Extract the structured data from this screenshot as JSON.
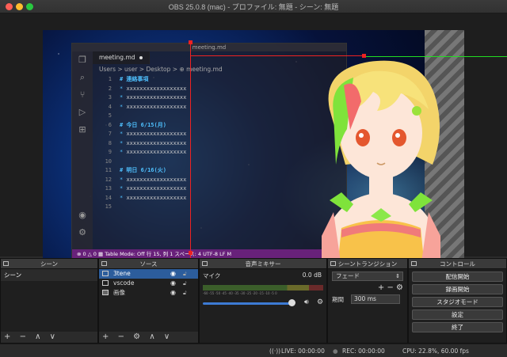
{
  "window": {
    "title": "OBS 25.0.8 (mac) - プロファイル: 無題 - シーン: 無題"
  },
  "preview": {
    "vscode": {
      "title": "meeting.md",
      "tab": "meeting.md",
      "breadcrumb": "Users > user > Desktop > ⊕ meeting.md",
      "lines": [
        {
          "n": "1",
          "kind": "hdr",
          "text": "# 連絡事項"
        },
        {
          "n": "2",
          "kind": "bul",
          "text": "xxxxxxxxxxxxxxxxxx"
        },
        {
          "n": "3",
          "kind": "bul",
          "text": "xxxxxxxxxxxxxxxxxx"
        },
        {
          "n": "4",
          "kind": "bul",
          "text": "xxxxxxxxxxxxxxxxxx"
        },
        {
          "n": "5",
          "kind": "blank",
          "text": ""
        },
        {
          "n": "6",
          "kind": "hdr",
          "text": "# 今日 6/15(月)"
        },
        {
          "n": "7",
          "kind": "bul",
          "text": "xxxxxxxxxxxxxxxxxx"
        },
        {
          "n": "8",
          "kind": "bul",
          "text": "xxxxxxxxxxxxxxxxxx"
        },
        {
          "n": "9",
          "kind": "bul",
          "text": "xxxxxxxxxxxxxxxxxx"
        },
        {
          "n": "10",
          "kind": "blank",
          "text": ""
        },
        {
          "n": "11",
          "kind": "hdr",
          "text": "# 明日 6/16(火)"
        },
        {
          "n": "12",
          "kind": "bul",
          "text": "xxxxxxxxxxxxxxxxxx"
        },
        {
          "n": "13",
          "kind": "bul",
          "text": "xxxxxxxxxxxxxxxxxx"
        },
        {
          "n": "14",
          "kind": "bul",
          "text": "xxxxxxxxxxxxxxxxxx"
        },
        {
          "n": "15",
          "kind": "blank",
          "text": ""
        }
      ],
      "status": "⊗ 0 △ 0   ▦ Table Mode: Off       行 15, 列 1   スペース: 4   UTF-8   LF   M"
    }
  },
  "docks": {
    "scenes": {
      "title": "シーン",
      "items": [
        "シーン"
      ],
      "footer": [
        "+",
        "−",
        "∧",
        "∨"
      ]
    },
    "sources": {
      "title": "ソース",
      "items": [
        {
          "name": "3tene",
          "selected": true
        },
        {
          "name": "vscode",
          "selected": false
        },
        {
          "name": "画像",
          "selected": false
        }
      ],
      "footer": [
        "+",
        "−",
        "⚙",
        "∧",
        "∨"
      ]
    },
    "mixer": {
      "title": "音声ミキサー",
      "channel": "マイク",
      "level": "0.0 dB",
      "ticks": "-60 -55 -50 -45 -40 -35 -30 -25 -20 -15 -10 -5 0",
      "volume": 0.92
    },
    "transitions": {
      "title": "シーントランジション",
      "type": "フェード",
      "duration_label": "期間",
      "duration_value": "300 ms"
    },
    "controls": {
      "title": "コントロール",
      "buttons": [
        "配信開始",
        "録画開始",
        "スタジオモード",
        "設定",
        "終了"
      ]
    }
  },
  "statusbar": {
    "live": "LIVE: 00:00:00",
    "rec": "REC: 00:00:00",
    "cpu": "CPU: 22.8%, 60.00 fps"
  },
  "icons": {
    "eye": "eye-icon",
    "lock": "lock-icon",
    "speaker": "speaker-icon",
    "gear": "gear-icon"
  }
}
